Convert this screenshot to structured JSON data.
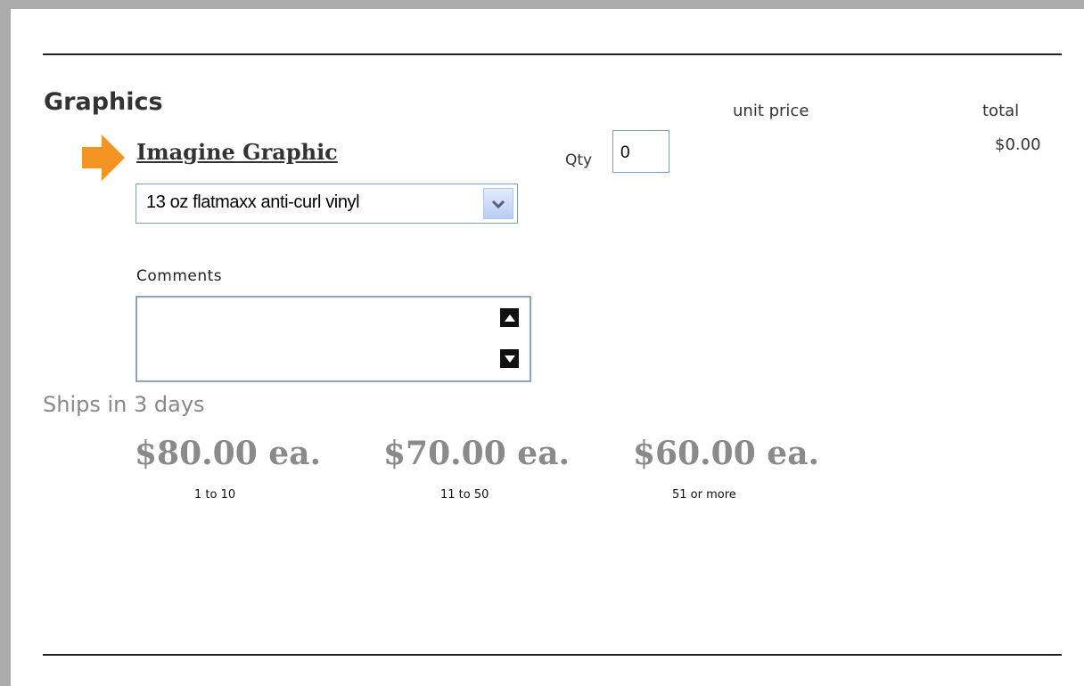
{
  "section": {
    "title": "Graphics",
    "unit_price_header": "unit price",
    "total_header": "total"
  },
  "product": {
    "name": "Imagine Graphic",
    "total": "$0.00",
    "qty_label": "Qty",
    "qty_value": "0",
    "material_selected": "13 oz flatmaxx anti-curl vinyl"
  },
  "comments": {
    "label": "Comments",
    "value": ""
  },
  "shipping": "Ships in 3 days",
  "price_tiers": [
    {
      "price": "$80.00 ea.",
      "range": "1 to 10"
    },
    {
      "price": "$70.00 ea.",
      "range": "11 to 50"
    },
    {
      "price": "$60.00 ea.",
      "range": "51 or more"
    }
  ],
  "icons": {
    "pointer": "arrow-right-icon",
    "dropdown": "chevron-down-icon",
    "scroll_up": "arrow-up-icon",
    "scroll_down": "arrow-down-icon"
  },
  "colors": {
    "arrow": "#f39423",
    "price_text": "#8a8a8a",
    "page_frame": "#ababab"
  }
}
